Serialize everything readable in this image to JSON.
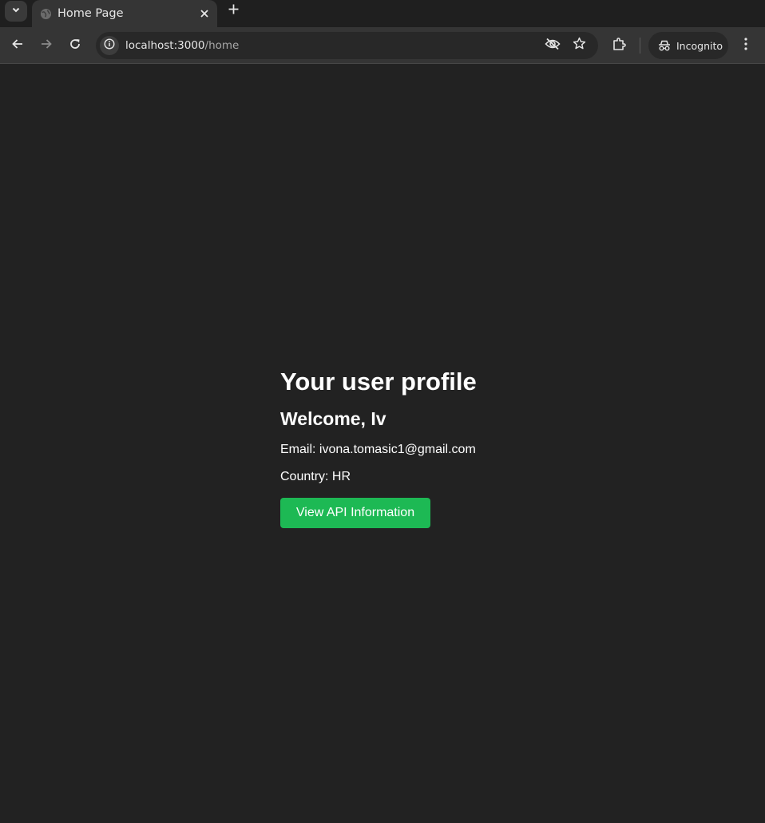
{
  "browser": {
    "tab_title": "Home Page",
    "url_host": "localhost:3000",
    "url_path": "/home",
    "incognito_label": "Incognito"
  },
  "profile": {
    "title": "Your user profile",
    "welcome": "Welcome, Iv",
    "email": "Email: ivona.tomasic1@gmail.com",
    "country": "Country: HR",
    "api_button_label": "View API Information"
  },
  "colors": {
    "page_background": "#222222",
    "button_green": "#1db954",
    "text": "#ffffff"
  },
  "icons": [
    "tab-search-icon",
    "globe-icon",
    "close-icon",
    "plus-icon",
    "back-icon",
    "forward-icon",
    "reload-icon",
    "info-icon",
    "eye-off-icon",
    "star-icon",
    "extensions-icon",
    "incognito-icon",
    "more-vert-icon"
  ]
}
